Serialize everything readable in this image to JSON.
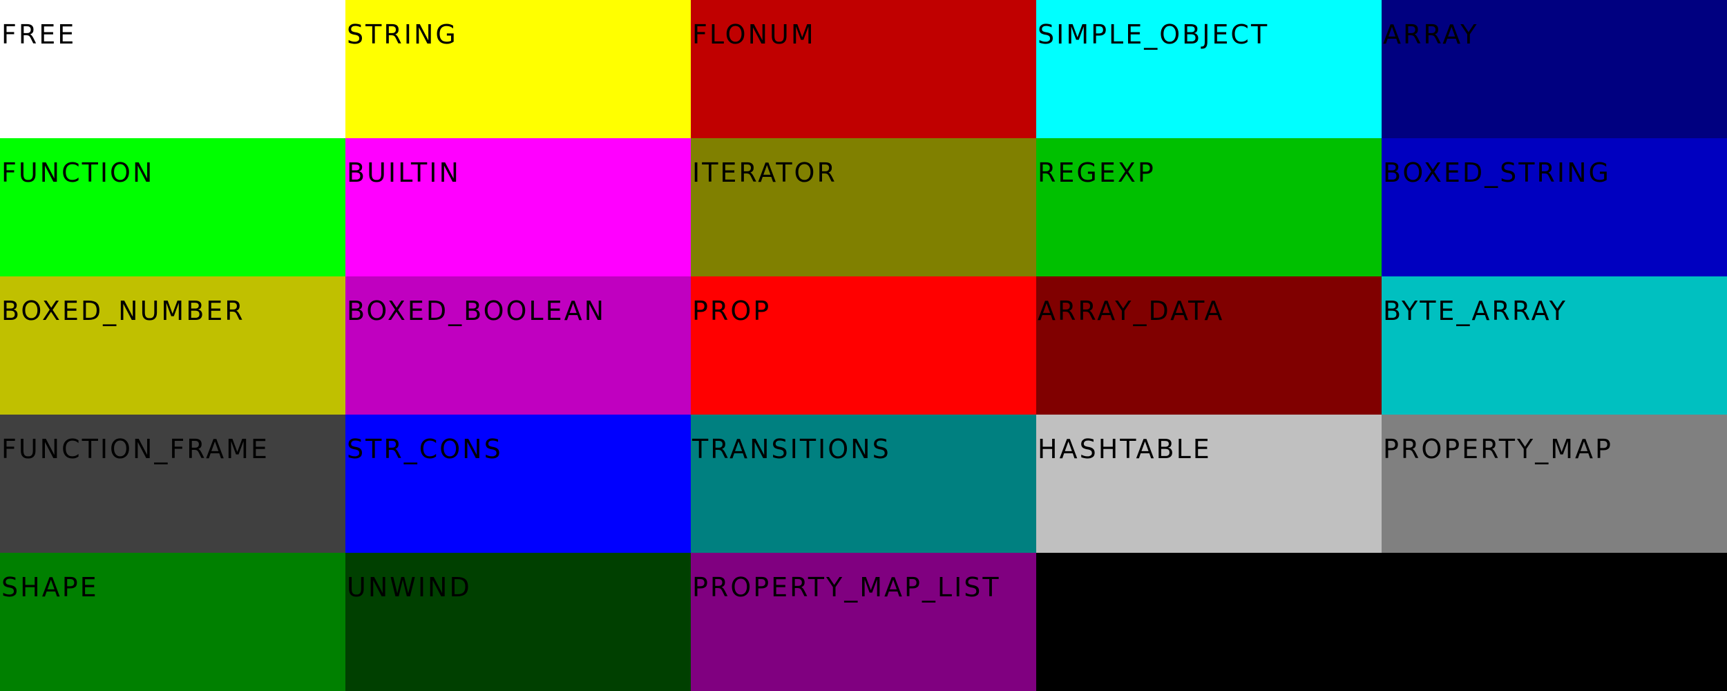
{
  "cells": [
    {
      "label": "FREE",
      "color": "#FFFFFF"
    },
    {
      "label": "STRING",
      "color": "#FFFF00"
    },
    {
      "label": "FLONUM",
      "color": "#C00000"
    },
    {
      "label": "SIMPLE_OBJECT",
      "color": "#00FFFF"
    },
    {
      "label": "ARRAY",
      "color": "#000080"
    },
    {
      "label": "FUNCTION",
      "color": "#00FF00"
    },
    {
      "label": "BUILTIN",
      "color": "#FF00FF"
    },
    {
      "label": "ITERATOR",
      "color": "#808000"
    },
    {
      "label": "REGEXP",
      "color": "#00C000"
    },
    {
      "label": "BOXED_STRING",
      "color": "#0000C0"
    },
    {
      "label": "BOXED_NUMBER",
      "color": "#C0C000"
    },
    {
      "label": "BOXED_BOOLEAN",
      "color": "#C000C0"
    },
    {
      "label": "PROP",
      "color": "#FF0000"
    },
    {
      "label": "ARRAY_DATA",
      "color": "#800000"
    },
    {
      "label": "BYTE_ARRAY",
      "color": "#00C0C0"
    },
    {
      "label": "FUNCTION_FRAME",
      "color": "#404040"
    },
    {
      "label": "STR_CONS",
      "color": "#0000FF"
    },
    {
      "label": "TRANSITIONS",
      "color": "#008080"
    },
    {
      "label": "HASHTABLE",
      "color": "#C0C0C0"
    },
    {
      "label": "PROPERTY_MAP",
      "color": "#808080"
    },
    {
      "label": "SHAPE",
      "color": "#008000"
    },
    {
      "label": "UNWIND",
      "color": "#004000"
    },
    {
      "label": "PROPERTY_MAP_LIST",
      "color": "#800080"
    },
    {
      "label": "",
      "color": "#000000"
    },
    {
      "label": "",
      "color": "#000000"
    }
  ]
}
